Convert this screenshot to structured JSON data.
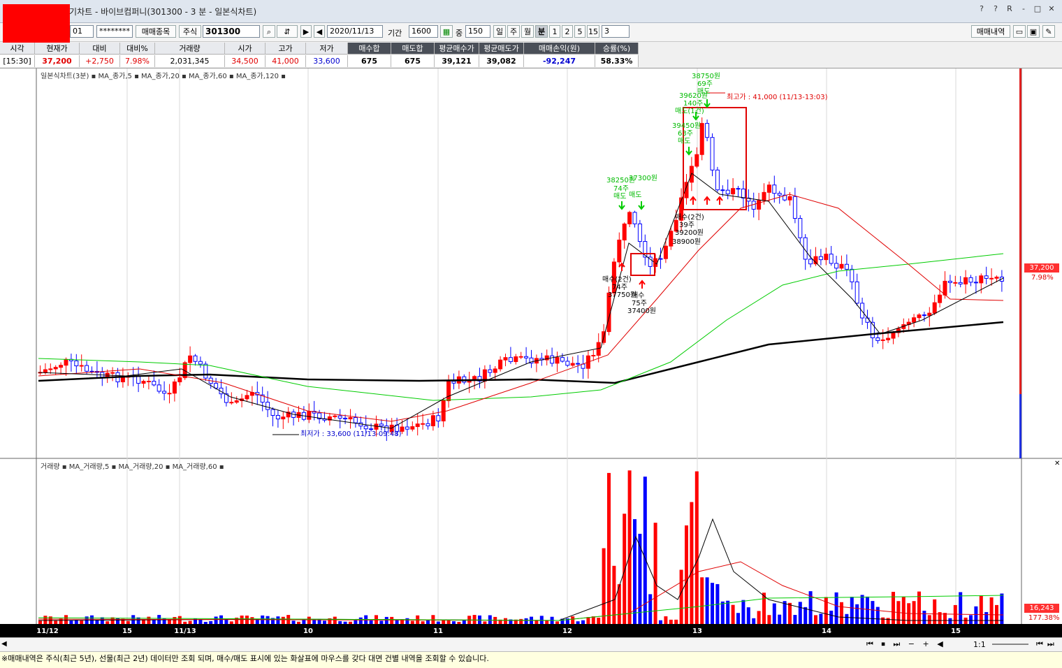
{
  "window": {
    "title": "[2450]매매복기차트 - 바이브컴퍼니(301300 - 3 분 - 일본식차트)",
    "controls": [
      "?",
      "?",
      "R",
      "-",
      "□",
      "✕"
    ]
  },
  "toolbar": {
    "account": "01",
    "password": "********",
    "btn_items": "매매종목",
    "market": "주식",
    "code": "301300",
    "date": "2020/11/13",
    "period_label": "기간",
    "period_value": "1600",
    "count_label": "중",
    "count_value": "150",
    "cycles": [
      "일",
      "주",
      "월",
      "분",
      "1",
      "2",
      "5",
      "15",
      "3"
    ],
    "btn_history": "매매내역"
  },
  "quote": {
    "headers": [
      "시각",
      "현재가",
      "대비",
      "대비%",
      "거래량",
      "시가",
      "고가",
      "저가",
      "매수합",
      "매도합",
      "평균매수가",
      "평균매도가",
      "매매손익(원)",
      "승률(%)"
    ],
    "values": [
      "[15:30]",
      "37,200",
      "+2,750",
      "7.98%",
      "2,031,345",
      "34,500",
      "41,000",
      "33,600",
      "675",
      "675",
      "39,121",
      "39,082",
      "-92,247",
      "58.33%"
    ]
  },
  "price_chart": {
    "legend": "일본식차트(3분) ▪ MA_종가,5 ▪ MA_종가,20 ▪ MA_종가,60 ▪ MA_종가,120 ▪",
    "last_price": "37,200",
    "last_pct": "7.98%",
    "high_label": "최고가 : 41,000 (11/13-13:03)",
    "low_label": "최저가 : 33,600 (11/13-09:48)",
    "annotations_buy": [
      "38250원",
      "74주",
      "매도",
      "37300원",
      "매도",
      "38750원",
      "69주",
      "매도",
      "39620원",
      "140주",
      "매도(1건)",
      "39450원",
      "63주",
      "매도"
    ],
    "annotations_sell": [
      "매수(2건)",
      "74주",
      "37750원",
      "매수",
      "75주",
      "37400원",
      "매수(2건)",
      "39주",
      "39200원",
      "38900원"
    ]
  },
  "volume_chart": {
    "legend": "거래량 ▪ MA_거래량,5 ▪ MA_거래량,20 ▪ MA_거래량,60 ▪",
    "last_volume": "16,243",
    "last_pct": "177.38%"
  },
  "x_axis": [
    "11/12",
    "15",
    "11/13",
    "10",
    "11",
    "12",
    "13",
    "14",
    "15"
  ],
  "scrollbar": {
    "ratio": "1:1"
  },
  "footer": "※매매내역은 주식(최근 5년), 선물(최근 2년) 데이터만 조회 되며, 매수/매도 표시에 있는 화살표에 마우스를 갖다 대면 건별 내역을 조회할 수 있습니다.",
  "colors": {
    "up": "#ff0000",
    "down": "#0000ff",
    "ma5": "#000000",
    "ma20": "#e00000",
    "ma60": "#00cc00",
    "ma120": "#000000",
    "buy_arrow": "#ff0000",
    "sell_arrow": "#00cc00"
  }
}
